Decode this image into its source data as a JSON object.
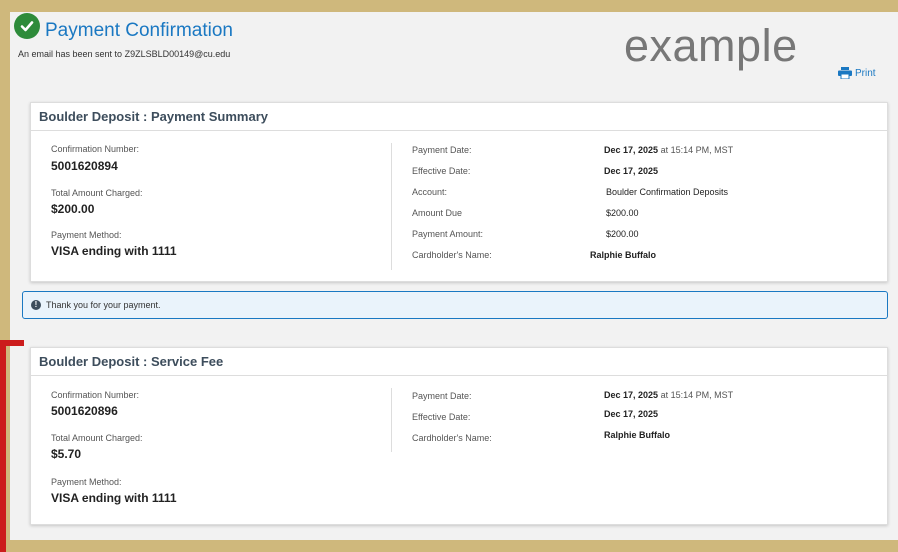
{
  "header": {
    "title": "Payment Confirmation",
    "email_notice": "An email has been sent to Z9ZLSBLD00149@cu.edu",
    "watermark": "example",
    "print_label": "Print"
  },
  "summary_card": {
    "title": "Boulder Deposit : Payment Summary",
    "left": {
      "confirmation_label": "Confirmation Number:",
      "confirmation_value": "5001620894",
      "total_label": "Total Amount Charged:",
      "total_value": "$200.00",
      "method_label": "Payment Method:",
      "method_value": "VISA ending with 1111"
    },
    "right": {
      "payment_date_label": "Payment Date:",
      "payment_date_value": "Dec 17, 2025",
      "payment_time": "at 15:14 PM, MST",
      "effective_date_label": "Effective Date:",
      "effective_date_value": "Dec 17, 2025",
      "account_label": "Account:",
      "account_value": "Boulder Confirmation Deposits",
      "amount_due_label": "Amount Due",
      "amount_due_value": "$200.00",
      "payment_amount_label": "Payment Amount:",
      "payment_amount_value": "$200.00",
      "cardholder_label": "Cardholder's Name:",
      "cardholder_value": "Ralphie Buffalo"
    }
  },
  "alert": {
    "icon": "exclamation-icon",
    "text": "Thank you for your payment."
  },
  "fee_card": {
    "title": "Boulder Deposit : Service Fee",
    "left": {
      "confirmation_label": "Confirmation Number:",
      "confirmation_value": "5001620896",
      "total_label": "Total Amount Charged:",
      "total_value": "$5.70",
      "method_label": "Payment Method:",
      "method_value": "VISA ending with 1111"
    },
    "right": {
      "payment_date_label": "Payment Date:",
      "payment_date_value": "Dec 17, 2025",
      "payment_time": "at 15:14 PM, MST",
      "effective_date_label": "Effective Date:",
      "effective_date_value": "Dec 17, 2025",
      "cardholder_label": "Cardholder's Name:",
      "cardholder_value": "Ralphie Buffalo"
    }
  },
  "colors": {
    "frame": "#cfb87c",
    "accent": "#1a78c2",
    "success": "#2e8b3a",
    "highlight": "#cc1c1c"
  }
}
